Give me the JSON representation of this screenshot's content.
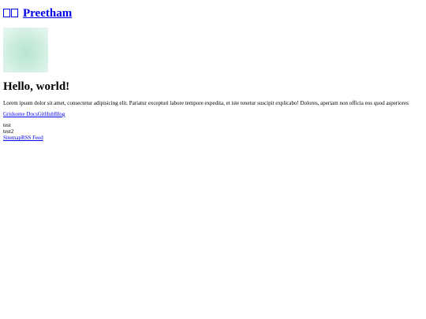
{
  "header": {
    "site_name": "Preetham"
  },
  "main": {
    "heading": "Hello, world!",
    "paragraph": "Lorem ipsum dolor sit amet, consectetur adipisicing elit. Pariatur excepturi labore tempore expedita, et iste tenetur suscipit explicabo! Dolores, aperiam non officia eos quod asperiores",
    "links": [
      {
        "label": "Gridsome Docs"
      },
      {
        "label": "GitHub"
      },
      {
        "label": "Blog"
      }
    ],
    "tests": [
      "test",
      "test2"
    ]
  },
  "footer": {
    "links": [
      {
        "label": "Sitemap"
      },
      {
        "label": "RSS Feed"
      }
    ]
  }
}
